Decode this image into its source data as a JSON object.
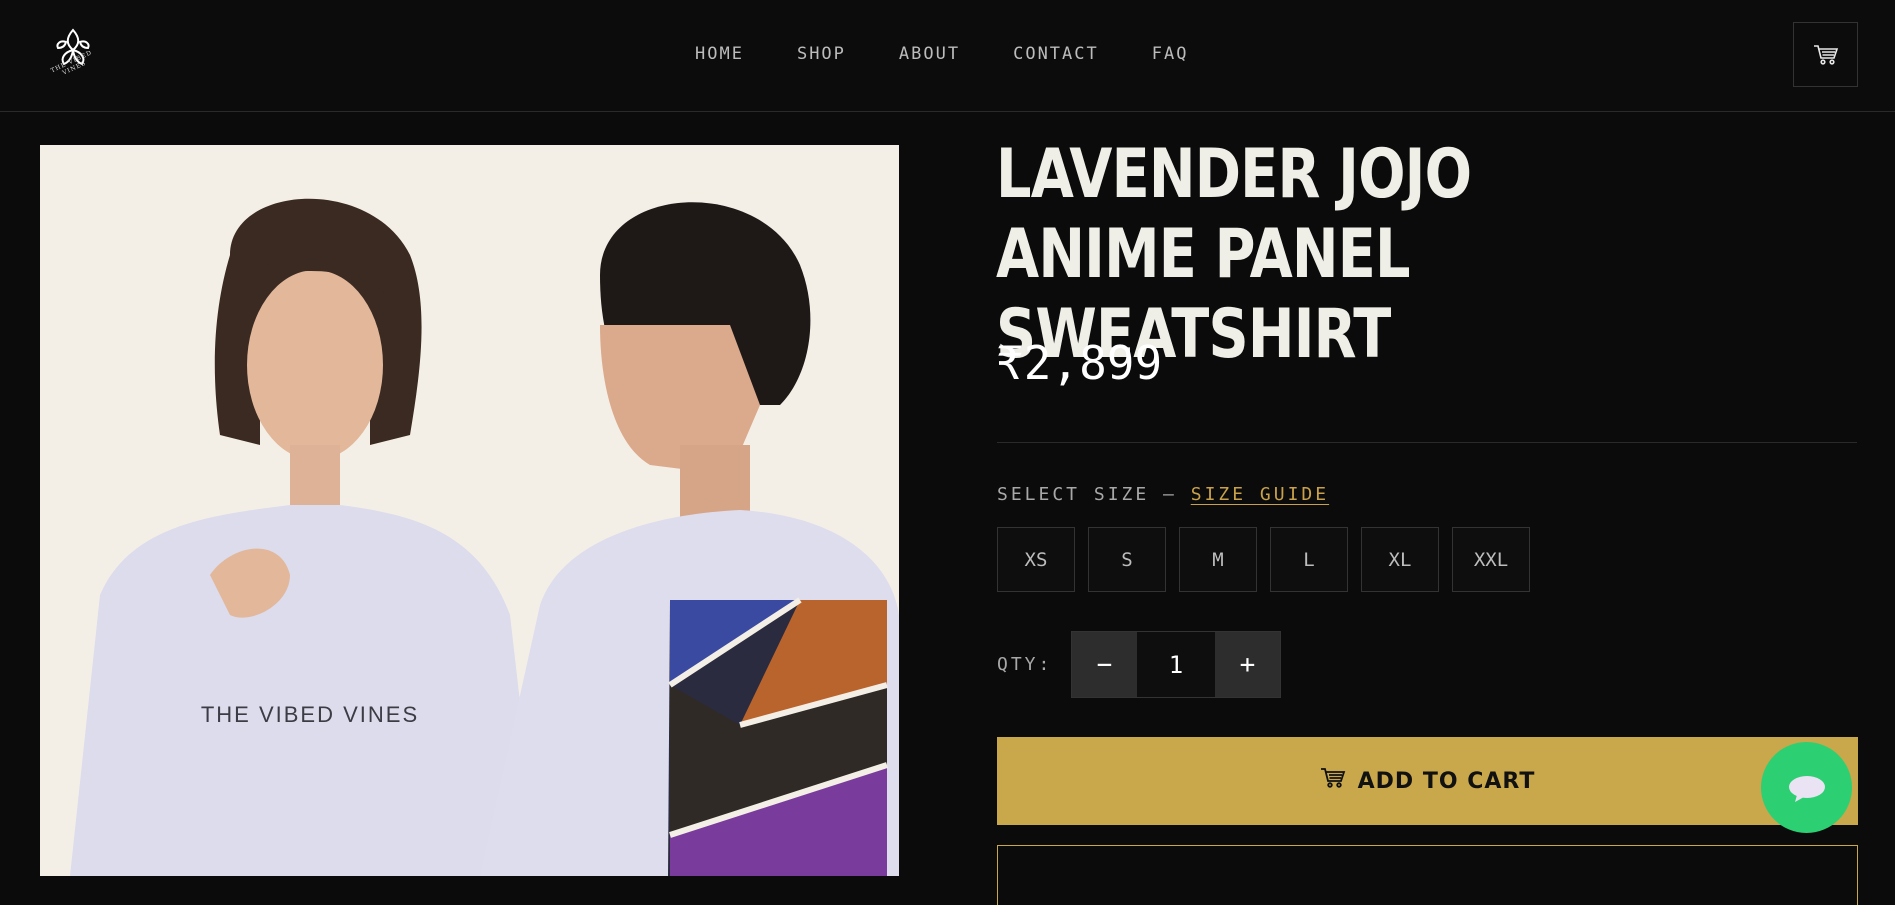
{
  "brand": {
    "name": "THE VIBED VINES"
  },
  "nav": {
    "items": [
      "HOME",
      "SHOP",
      "ABOUT",
      "CONTACT",
      "FAQ"
    ]
  },
  "header": {
    "cart_icon": "cart-icon"
  },
  "product": {
    "title": "LAVENDER JOJO ANIME PANEL SWEATSHIRT",
    "price": "₹2,899",
    "image_text": "THE VIBED VINES",
    "size_label": "SELECT SIZE —",
    "size_guide": "SIZE GUIDE",
    "sizes": [
      "XS",
      "S",
      "M",
      "L",
      "XL",
      "XXL"
    ],
    "qty_label": "QTY:",
    "qty_value": "1",
    "qty_minus": "−",
    "qty_plus": "+",
    "add_to_cart": "ADD TO CART"
  },
  "colors": {
    "background": "#0b0b0b",
    "accent_gold": "#c9a74b",
    "chat_green": "#2dcf73"
  }
}
